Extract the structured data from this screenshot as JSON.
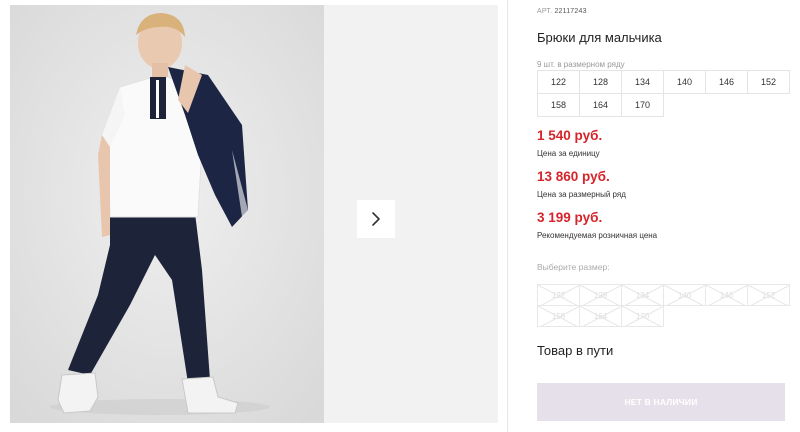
{
  "product": {
    "article_label": "АРТ.",
    "article_number": "22117243",
    "title": "Брюки для мальчика"
  },
  "size_row": {
    "count_text": "9 шт. в размерном ряду",
    "sizes": [
      "122",
      "128",
      "134",
      "140",
      "146",
      "152",
      "158",
      "164",
      "170"
    ]
  },
  "prices": {
    "unit_price": "1 540 руб.",
    "unit_note": "Цена за единицу",
    "row_price": "13 860 руб.",
    "row_note": "Цена за размерный ряд",
    "retail_price": "3 199 руб.",
    "retail_note": "Рекомендуемая розничная цена",
    "accent_color": "#d6242b"
  },
  "size_select": {
    "label": "Выберите размер:",
    "options": [
      "122",
      "128",
      "134",
      "140",
      "146",
      "152",
      "158",
      "164",
      "170"
    ]
  },
  "availability": {
    "status": "Товар в пути",
    "button_label": "НЕТ В НАЛИЧИИ",
    "button_color": "#e6e0ea"
  },
  "gallery": {
    "next_icon": "chevron-right-icon",
    "photo_alt": "boy-model-photo"
  }
}
